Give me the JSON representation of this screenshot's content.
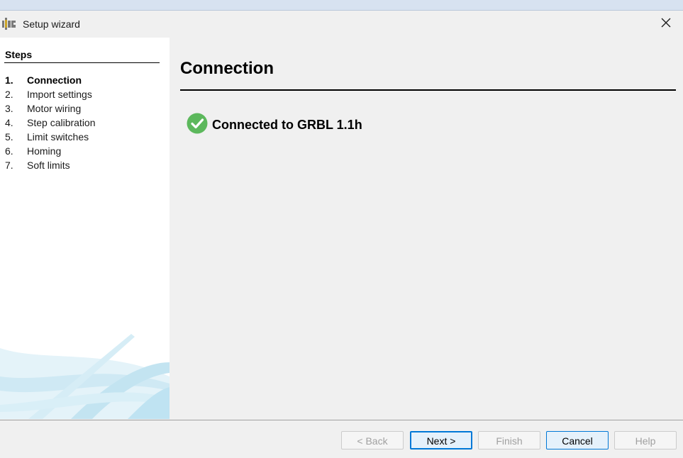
{
  "window": {
    "title": "Setup wizard",
    "icon": "app-logo-icon",
    "close_icon": "close-icon"
  },
  "sidebar": {
    "heading": "Steps",
    "steps": [
      {
        "num": "1.",
        "label": "Connection",
        "active": true
      },
      {
        "num": "2.",
        "label": "Import settings",
        "active": false
      },
      {
        "num": "3.",
        "label": "Motor wiring",
        "active": false
      },
      {
        "num": "4.",
        "label": "Step calibration",
        "active": false
      },
      {
        "num": "5.",
        "label": "Limit switches",
        "active": false
      },
      {
        "num": "6.",
        "label": "Homing",
        "active": false
      },
      {
        "num": "7.",
        "label": "Soft limits",
        "active": false
      }
    ]
  },
  "main": {
    "title": "Connection",
    "status_text": "Connected to GRBL 1.1h",
    "status_icon": "check-circle-icon"
  },
  "buttons": {
    "back": "< Back",
    "next": "Next >",
    "finish": "Finish",
    "cancel": "Cancel",
    "help": "Help"
  },
  "colors": {
    "success": "#5cb85c",
    "accent": "#0078d7",
    "decor": "#bfe3f2"
  }
}
